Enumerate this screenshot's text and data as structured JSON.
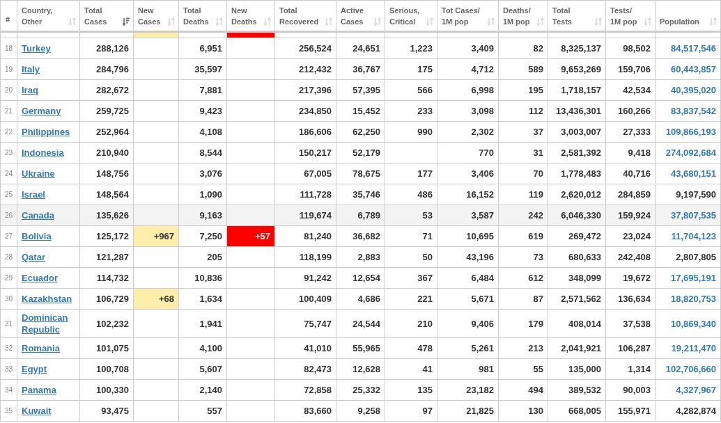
{
  "table": {
    "columns": [
      {
        "label": "#",
        "sortable": false,
        "sorted": false
      },
      {
        "label": "Country,\nOther",
        "sortable": true,
        "sorted": false
      },
      {
        "label": "Total\nCases",
        "sortable": true,
        "sorted": true
      },
      {
        "label": "New\nCases",
        "sortable": true,
        "sorted": false
      },
      {
        "label": "Total\nDeaths",
        "sortable": true,
        "sorted": false
      },
      {
        "label": "New\nDeaths",
        "sortable": true,
        "sorted": false
      },
      {
        "label": "Total\nRecovered",
        "sortable": true,
        "sorted": false
      },
      {
        "label": "Active\nCases",
        "sortable": true,
        "sorted": false
      },
      {
        "label": "Serious,\nCritical",
        "sortable": true,
        "sorted": false
      },
      {
        "label": "Tot Cases/\n1M pop",
        "sortable": true,
        "sorted": false
      },
      {
        "label": "Deaths/\n1M pop",
        "sortable": true,
        "sorted": false
      },
      {
        "label": "Total\nTests",
        "sortable": true,
        "sorted": false
      },
      {
        "label": "Tests/\n1M pop",
        "sortable": true,
        "sorted": false
      },
      {
        "label": "Population",
        "sortable": true,
        "sorted": false
      }
    ],
    "rows": [
      {
        "clipped": true,
        "highlighted": false,
        "new_cases_flag": true,
        "new_deaths_flag": true,
        "population_link": false,
        "cells": [
          null,
          null,
          null,
          null,
          null,
          null,
          null,
          null,
          null,
          null,
          null,
          null,
          null,
          null
        ]
      },
      {
        "clipped": false,
        "highlighted": false,
        "new_cases_flag": false,
        "new_deaths_flag": false,
        "population_link": true,
        "cells": [
          "18",
          "Turkey",
          "288,126",
          null,
          "6,951",
          null,
          "256,524",
          "24,651",
          "1,223",
          "3,409",
          "82",
          "8,325,137",
          "98,502",
          "84,517,546"
        ]
      },
      {
        "clipped": false,
        "highlighted": false,
        "new_cases_flag": false,
        "new_deaths_flag": false,
        "population_link": true,
        "cells": [
          "19",
          "Italy",
          "284,796",
          null,
          "35,597",
          null,
          "212,432",
          "36,767",
          "175",
          "4,712",
          "589",
          "9,653,269",
          "159,706",
          "60,443,857"
        ]
      },
      {
        "clipped": false,
        "highlighted": false,
        "new_cases_flag": false,
        "new_deaths_flag": false,
        "population_link": true,
        "cells": [
          "20",
          "Iraq",
          "282,672",
          null,
          "7,881",
          null,
          "217,396",
          "57,395",
          "566",
          "6,998",
          "195",
          "1,718,157",
          "42,534",
          "40,395,020"
        ]
      },
      {
        "clipped": false,
        "highlighted": false,
        "new_cases_flag": false,
        "new_deaths_flag": false,
        "population_link": true,
        "cells": [
          "21",
          "Germany",
          "259,725",
          null,
          "9,423",
          null,
          "234,850",
          "15,452",
          "233",
          "3,098",
          "112",
          "13,436,301",
          "160,266",
          "83,837,542"
        ]
      },
      {
        "clipped": false,
        "highlighted": false,
        "new_cases_flag": false,
        "new_deaths_flag": false,
        "population_link": true,
        "cells": [
          "22",
          "Philippines",
          "252,964",
          null,
          "4,108",
          null,
          "186,606",
          "62,250",
          "990",
          "2,302",
          "37",
          "3,003,007",
          "27,333",
          "109,866,193"
        ]
      },
      {
        "clipped": false,
        "highlighted": false,
        "new_cases_flag": false,
        "new_deaths_flag": false,
        "population_link": true,
        "cells": [
          "23",
          "Indonesia",
          "210,940",
          null,
          "8,544",
          null,
          "150,217",
          "52,179",
          null,
          "770",
          "31",
          "2,581,392",
          "9,418",
          "274,092,684"
        ]
      },
      {
        "clipped": false,
        "highlighted": false,
        "new_cases_flag": false,
        "new_deaths_flag": false,
        "population_link": true,
        "cells": [
          "24",
          "Ukraine",
          "148,756",
          null,
          "3,076",
          null,
          "67,005",
          "78,675",
          "177",
          "3,406",
          "70",
          "1,778,483",
          "40,716",
          "43,680,151"
        ]
      },
      {
        "clipped": false,
        "highlighted": false,
        "new_cases_flag": false,
        "new_deaths_flag": false,
        "population_link": false,
        "cells": [
          "25",
          "Israel",
          "148,564",
          null,
          "1,090",
          null,
          "111,728",
          "35,746",
          "486",
          "16,152",
          "119",
          "2,620,012",
          "284,859",
          "9,197,590"
        ]
      },
      {
        "clipped": false,
        "highlighted": true,
        "new_cases_flag": false,
        "new_deaths_flag": false,
        "population_link": true,
        "cells": [
          "26",
          "Canada",
          "135,626",
          null,
          "9,163",
          null,
          "119,674",
          "6,789",
          "53",
          "3,587",
          "242",
          "6,046,330",
          "159,924",
          "37,807,535"
        ]
      },
      {
        "clipped": false,
        "highlighted": false,
        "new_cases_flag": true,
        "new_deaths_flag": true,
        "population_link": true,
        "cells": [
          "27",
          "Bolivia",
          "125,172",
          "+967",
          "7,250",
          "+57",
          "81,240",
          "36,682",
          "71",
          "10,695",
          "619",
          "269,472",
          "23,024",
          "11,704,123"
        ]
      },
      {
        "clipped": false,
        "highlighted": false,
        "new_cases_flag": false,
        "new_deaths_flag": false,
        "population_link": false,
        "cells": [
          "28",
          "Qatar",
          "121,287",
          null,
          "205",
          null,
          "118,199",
          "2,883",
          "50",
          "43,196",
          "73",
          "680,633",
          "242,408",
          "2,807,805"
        ]
      },
      {
        "clipped": false,
        "highlighted": false,
        "new_cases_flag": false,
        "new_deaths_flag": false,
        "population_link": true,
        "cells": [
          "29",
          "Ecuador",
          "114,732",
          null,
          "10,836",
          null,
          "91,242",
          "12,654",
          "367",
          "6,484",
          "612",
          "348,099",
          "19,672",
          "17,695,191"
        ]
      },
      {
        "clipped": false,
        "highlighted": false,
        "new_cases_flag": true,
        "new_deaths_flag": false,
        "population_link": true,
        "cells": [
          "30",
          "Kazakhstan",
          "106,729",
          "+68",
          "1,634",
          null,
          "100,409",
          "4,686",
          "221",
          "5,671",
          "87",
          "2,571,562",
          "136,634",
          "18,820,753"
        ]
      },
      {
        "clipped": false,
        "highlighted": false,
        "new_cases_flag": false,
        "new_deaths_flag": false,
        "population_link": true,
        "cells": [
          "31",
          "Dominican Republic",
          "102,232",
          null,
          "1,941",
          null,
          "75,747",
          "24,544",
          "210",
          "9,406",
          "179",
          "408,014",
          "37,538",
          "10,869,340"
        ]
      },
      {
        "clipped": false,
        "highlighted": false,
        "new_cases_flag": false,
        "new_deaths_flag": false,
        "population_link": true,
        "cells": [
          "32",
          "Romania",
          "101,075",
          null,
          "4,100",
          null,
          "41,010",
          "55,965",
          "478",
          "5,261",
          "213",
          "2,041,921",
          "106,287",
          "19,211,470"
        ]
      },
      {
        "clipped": false,
        "highlighted": false,
        "new_cases_flag": false,
        "new_deaths_flag": false,
        "population_link": true,
        "cells": [
          "33",
          "Egypt",
          "100,708",
          null,
          "5,607",
          null,
          "82,473",
          "12,628",
          "41",
          "981",
          "55",
          "135,000",
          "1,314",
          "102,706,660"
        ]
      },
      {
        "clipped": false,
        "highlighted": false,
        "new_cases_flag": false,
        "new_deaths_flag": false,
        "population_link": true,
        "cells": [
          "34",
          "Panama",
          "100,330",
          null,
          "2,140",
          null,
          "72,858",
          "25,332",
          "135",
          "23,182",
          "494",
          "389,532",
          "90,003",
          "4,327,967"
        ]
      },
      {
        "clipped": false,
        "highlighted": false,
        "new_cases_flag": false,
        "new_deaths_flag": false,
        "population_link": false,
        "cells": [
          "35",
          "Kuwait",
          "93,475",
          null,
          "557",
          null,
          "83,660",
          "9,258",
          "97",
          "21,825",
          "130",
          "668,005",
          "155,971",
          "4,282,874"
        ]
      }
    ]
  }
}
